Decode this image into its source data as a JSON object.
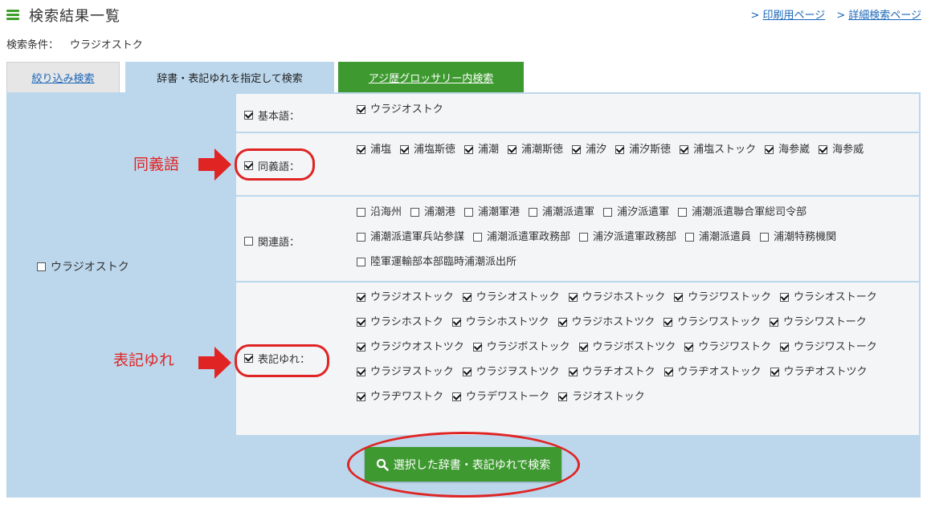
{
  "header": {
    "title": "検索結果一覧",
    "links": [
      "印刷用ページ",
      "詳細検索ページ"
    ]
  },
  "condition": {
    "label": "検索条件：",
    "value": "ウラジオストク"
  },
  "tabs": [
    {
      "label": "絞り込み検索"
    },
    {
      "label": "辞書・表記ゆれを指定して検索"
    },
    {
      "label": "アジ歴グロッサリー内検索"
    }
  ],
  "main_option": {
    "label": "ウラジオストク",
    "checked": false
  },
  "rows": [
    {
      "label": "基本語：",
      "checked": true,
      "options": [
        {
          "label": "ウラジオストク",
          "checked": true
        }
      ]
    },
    {
      "label": "同義語：",
      "checked": true,
      "options": [
        {
          "label": "浦塩",
          "checked": true
        },
        {
          "label": "浦塩斯徳",
          "checked": true
        },
        {
          "label": "浦潮",
          "checked": true
        },
        {
          "label": "浦潮斯徳",
          "checked": true
        },
        {
          "label": "浦汐",
          "checked": true
        },
        {
          "label": "浦汐斯徳",
          "checked": true
        },
        {
          "label": "浦塩ストック",
          "checked": true
        },
        {
          "label": "海参崴",
          "checked": true
        },
        {
          "label": "海参威",
          "checked": true
        }
      ]
    },
    {
      "label": "関連語：",
      "checked": false,
      "options": [
        {
          "label": "沿海州",
          "checked": false
        },
        {
          "label": "浦潮港",
          "checked": false
        },
        {
          "label": "浦潮軍港",
          "checked": false
        },
        {
          "label": "浦潮派遣軍",
          "checked": false
        },
        {
          "label": "浦汐派遣軍",
          "checked": false
        },
        {
          "label": "浦潮派遣聯合軍総司令部",
          "checked": false
        },
        {
          "label": "浦潮派遣軍兵站参謀",
          "checked": false
        },
        {
          "label": "浦潮派遣軍政務部",
          "checked": false
        },
        {
          "label": "浦汐派遣軍政務部",
          "checked": false
        },
        {
          "label": "浦潮派遣員",
          "checked": false
        },
        {
          "label": "浦潮特務機関",
          "checked": false
        },
        {
          "label": "陸軍運輸部本部臨時浦潮派出所",
          "checked": false
        }
      ]
    },
    {
      "label": "表記ゆれ：",
      "checked": true,
      "options": [
        {
          "label": "ウラジオストック",
          "checked": true
        },
        {
          "label": "ウラシオストック",
          "checked": true
        },
        {
          "label": "ウラジホストック",
          "checked": true
        },
        {
          "label": "ウラジワストック",
          "checked": true
        },
        {
          "label": "ウラシオストーク",
          "checked": true
        },
        {
          "label": "ウラシホストク",
          "checked": true
        },
        {
          "label": "ウラシホストツク",
          "checked": true
        },
        {
          "label": "ウラジホストツク",
          "checked": true
        },
        {
          "label": "ウラシワストック",
          "checked": true
        },
        {
          "label": "ウラシワストーク",
          "checked": true
        },
        {
          "label": "ウラジウオストツク",
          "checked": true
        },
        {
          "label": "ウラジボストック",
          "checked": true
        },
        {
          "label": "ウラジボストツク",
          "checked": true
        },
        {
          "label": "ウラジワストク",
          "checked": true
        },
        {
          "label": "ウラジワストーク",
          "checked": true
        },
        {
          "label": "ウラジヲストック",
          "checked": true
        },
        {
          "label": "ウラジヲストツク",
          "checked": true
        },
        {
          "label": "ウラチオストク",
          "checked": true
        },
        {
          "label": "ウラヂオストック",
          "checked": true
        },
        {
          "label": "ウラヂオストツク",
          "checked": true
        },
        {
          "label": "ウラヂワストク",
          "checked": true
        },
        {
          "label": "ウラデワストーク",
          "checked": true
        },
        {
          "label": "ラジオストック",
          "checked": true
        }
      ]
    }
  ],
  "annotations": [
    "同義語",
    "表記ゆれ"
  ],
  "search_button": {
    "label": "選択した辞書・表記ゆれで検索"
  },
  "colors": {
    "accent_green": "#3e9a30",
    "panel_blue": "#bcd7ec",
    "annotation_red": "#e02424",
    "link_blue": "#1a66b8"
  }
}
